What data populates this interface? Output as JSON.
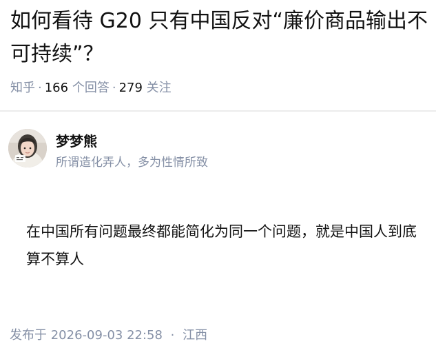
{
  "question": {
    "title": "如何看待 G20 只有中国反对“廉价商品输出不可持续”？",
    "source": "知乎",
    "answer_count": "166",
    "answer_unit": "个回答",
    "follower_count": "279",
    "follower_unit": "关注"
  },
  "answer": {
    "author_name": "梦梦熊",
    "author_bio": "所谓造化弄人，多为性情所致",
    "content": "在中国所有问题最终都能简化为同一个问题，就是中国人到底算不算人",
    "published_label": "发布于",
    "published_time": "2026-09-03 22:58",
    "location": "江西"
  },
  "colors": {
    "primary_text": "#121212",
    "secondary_text": "#8590a6",
    "divider": "#ececec"
  }
}
